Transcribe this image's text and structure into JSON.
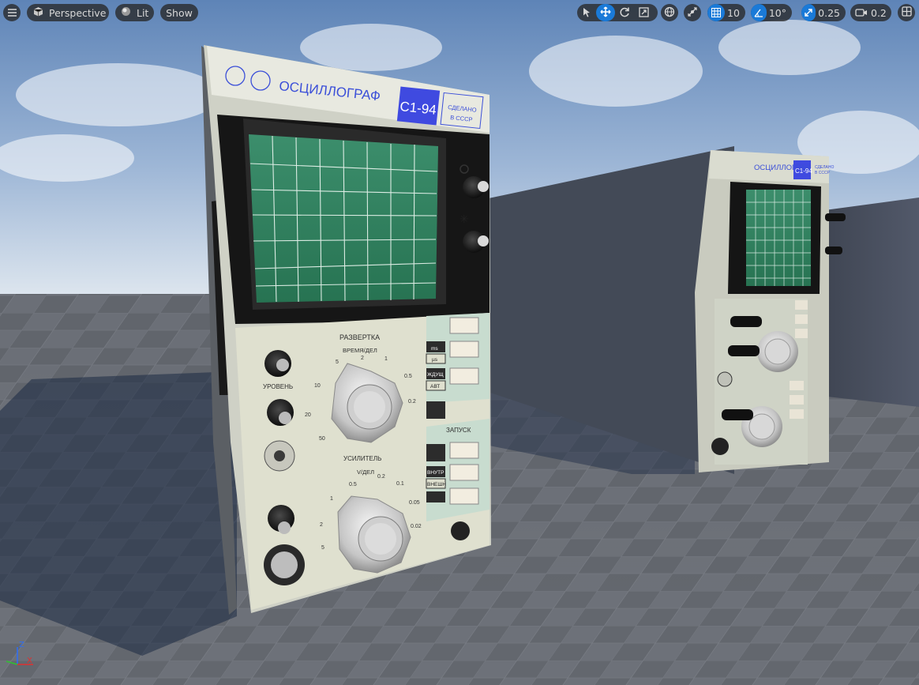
{
  "toolbar": {
    "menu_icon": "hamburger-icon",
    "view_mode": "Perspective",
    "lighting_mode": "Lit",
    "show_label": "Show",
    "grid_snap_value": "10",
    "rotation_snap_value": "10°",
    "scale_snap_value": "0.25",
    "camera_speed_value": "0.2"
  },
  "scene": {
    "front_device": {
      "title": "ОСЦИЛЛОГРАФ",
      "model": "С1-94",
      "origin_line1": "СДЕЛАНО",
      "origin_line2": "В СССР",
      "sweep_label": "РАЗВЕРТКА",
      "time_div_label": "ВРЕМЯ/ДЕЛ",
      "level_label": "УРОВЕНЬ",
      "trigger_label": "ЗАПУСК",
      "amplifier_label": "УСИЛИТЕЛЬ",
      "volt_div_label": "V/ДЕЛ",
      "ms_label": "ms",
      "us_label": "µs",
      "auto_label1": "ЖДУЩ",
      "auto_label2": "АВТ",
      "int_label1": "ВНУТР",
      "int_label2": "ВНЕШН",
      "time_scale": [
        "10",
        "20",
        "50",
        "0.5",
        "0.2",
        "1",
        "2",
        "5"
      ],
      "volt_scale": [
        "1",
        "0.5",
        "0.2",
        "0.1",
        "0.05",
        "0.02",
        "2",
        "5"
      ]
    },
    "back_device": {
      "title": "ОСЦИЛЛОГРАФ",
      "model": "С1-94",
      "origin_line1": "СДЕЛАНО",
      "origin_line2": "В СССР"
    }
  },
  "axis_widget": {
    "z": "Z",
    "x": "X"
  },
  "colors": {
    "accent": "#1a7ad8",
    "label_blue": "#3b4fd8",
    "panel": "#dfe0cf",
    "screen": "#2e7a5a"
  }
}
